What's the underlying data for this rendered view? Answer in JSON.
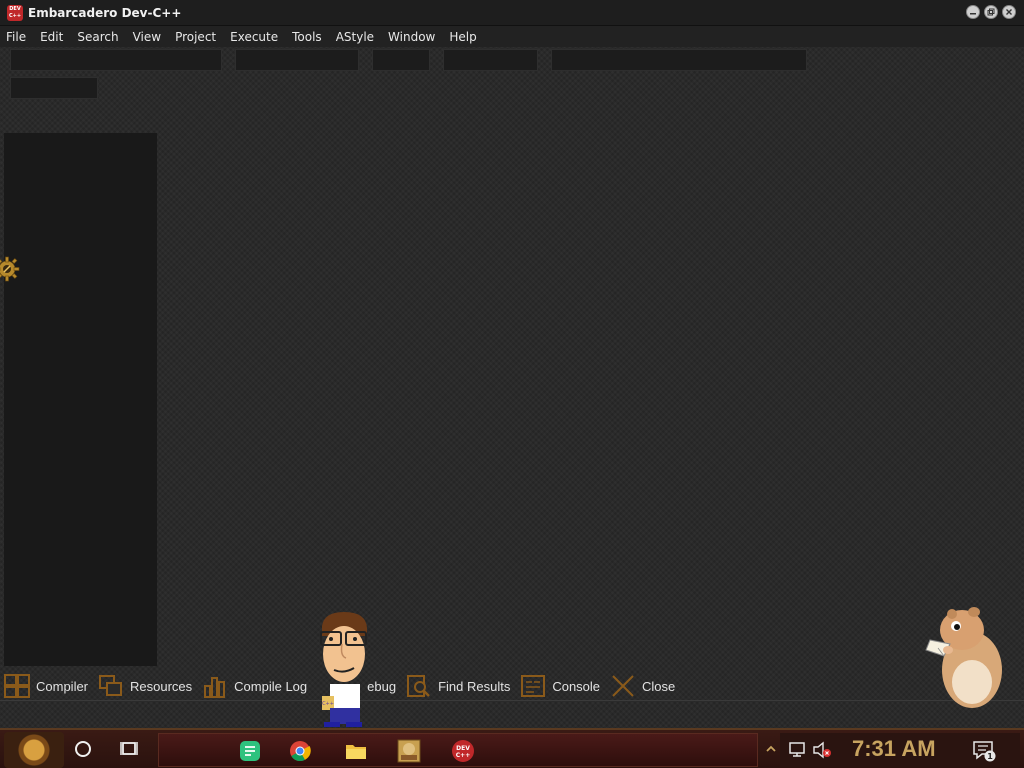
{
  "window": {
    "title": "Embarcadero Dev-C++",
    "icon_text": "DEV C++"
  },
  "menu": [
    "File",
    "Edit",
    "Search",
    "View",
    "Project",
    "Execute",
    "Tools",
    "AStyle",
    "Window",
    "Help"
  ],
  "bottom_tabs": [
    {
      "label": "Compiler",
      "icon": "compiler-icon"
    },
    {
      "label": "Resources",
      "icon": "resources-icon"
    },
    {
      "label": "Compile Log",
      "icon": "compile-log-icon"
    },
    {
      "label": "ebug",
      "icon": "debug-icon"
    },
    {
      "label": "Find Results",
      "icon": "find-results-icon"
    },
    {
      "label": "Console",
      "icon": "console-icon"
    },
    {
      "label": "Close",
      "icon": "close-icon"
    }
  ],
  "taskbar": {
    "clock": "7:31 AM",
    "notification_count": "1"
  },
  "colors": {
    "background": "#2a2a2a",
    "panel": "#191919",
    "clock": "#c8a460",
    "taskbar": "#3a1a14"
  }
}
